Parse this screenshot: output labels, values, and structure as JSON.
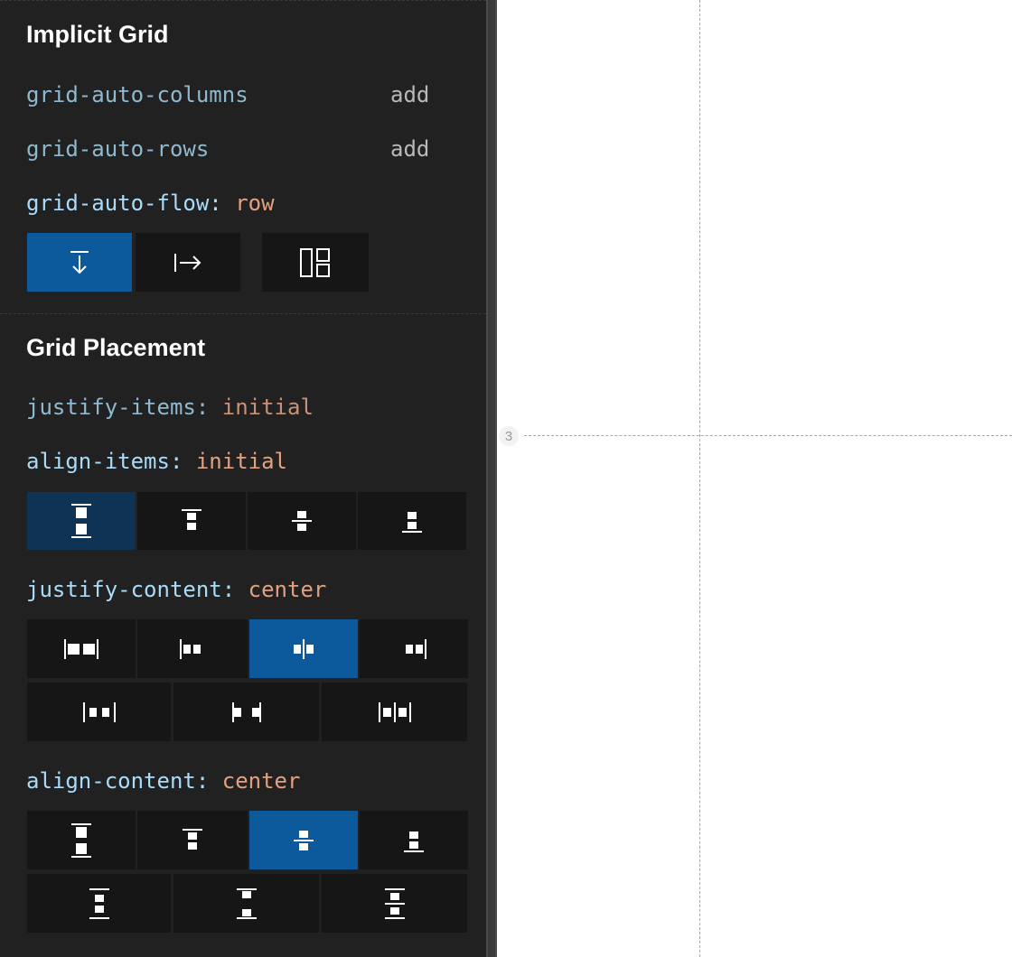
{
  "implicit_grid": {
    "title": "Implicit Grid",
    "auto_columns": {
      "name": "grid-auto-columns",
      "action": "add"
    },
    "auto_rows": {
      "name": "grid-auto-rows",
      "action": "add"
    },
    "auto_flow": {
      "name": "grid-auto-flow",
      "colon": ":",
      "value": "row",
      "options": [
        "arrow-down-icon",
        "arrow-right-icon",
        "dense-layout-icon"
      ],
      "selected": "arrow-down-icon"
    }
  },
  "grid_placement": {
    "title": "Grid Placement",
    "justify_items": {
      "name": "justify-items",
      "colon": ":",
      "value": "initial"
    },
    "align_items": {
      "name": "align-items",
      "colon": ":",
      "value": "initial",
      "options": [
        "align-stretch-icon",
        "align-start-icon",
        "align-center-icon",
        "align-end-icon"
      ],
      "selected": "align-stretch-icon"
    },
    "justify_content": {
      "name": "justify-content",
      "colon": ":",
      "value": "center",
      "options": [
        "justify-stretch-icon",
        "justify-start-icon",
        "justify-center-icon",
        "justify-end-icon",
        "justify-space-around-icon",
        "justify-space-between-icon",
        "justify-space-evenly-icon"
      ],
      "selected": "justify-center-icon"
    },
    "align_content": {
      "name": "align-content",
      "colon": ":",
      "value": "center",
      "options": [
        "align-stretch-icon",
        "align-start-icon",
        "align-center-icon",
        "align-end-icon",
        "align-space-around-icon",
        "align-space-between-icon",
        "align-space-evenly-icon"
      ],
      "selected": "align-center-icon"
    }
  },
  "canvas": {
    "grid_line_number": "3"
  },
  "colors": {
    "panel_bg": "#212121",
    "button_bg": "#161616",
    "selected": "#0c5a9c",
    "selected_dim": "#0f3354",
    "prop_name": "#a9dcfa",
    "prop_value": "#e3a081"
  }
}
